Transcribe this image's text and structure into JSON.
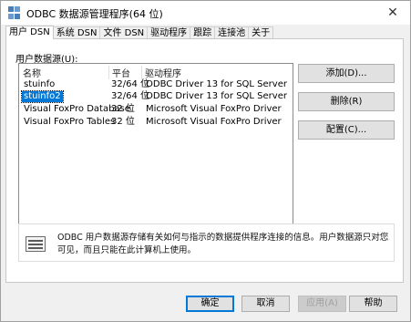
{
  "window": {
    "title": "ODBC 数据源管理程序(64 位)",
    "close_glyph": "✕"
  },
  "tabs": [
    {
      "label": "用户 DSN",
      "active": true
    },
    {
      "label": "系统 DSN"
    },
    {
      "label": "文件 DSN"
    },
    {
      "label": "驱动程序"
    },
    {
      "label": "跟踪"
    },
    {
      "label": "连接池"
    },
    {
      "label": "关于"
    }
  ],
  "panel": {
    "label": "用户数据源(U):",
    "columns": [
      "名称",
      "平台",
      "驱动程序"
    ],
    "rows": [
      {
        "name": "stuinfo",
        "platform": "32/64 位",
        "driver": "ODBC Driver 13 for SQL Server",
        "selected": false
      },
      {
        "name": "stuinfo2",
        "platform": "32/64 位",
        "driver": "ODBC Driver 13 for SQL Server",
        "selected": true
      },
      {
        "name": "Visual FoxPro Database",
        "platform": "32 位",
        "driver": "Microsoft Visual FoxPro Driver",
        "selected": false
      },
      {
        "name": "Visual FoxPro Tables",
        "platform": "32 位",
        "driver": "Microsoft Visual FoxPro Driver",
        "selected": false
      }
    ],
    "buttons": {
      "add": "添加(D)...",
      "remove": "删除(R)",
      "configure": "配置(C)..."
    },
    "info_text": "ODBC 用户数据源存储有关如何与指示的数据提供程序连接的信息。用户数据源只对您可见，而且只能在此计算机上使用。"
  },
  "footer": {
    "ok": "确定",
    "cancel": "取消",
    "apply": "应用(A)",
    "help": "帮助"
  },
  "colors": {
    "selection": "#0078d7",
    "button_face": "#e1e1e1",
    "window_bg": "#f0f0f0"
  }
}
